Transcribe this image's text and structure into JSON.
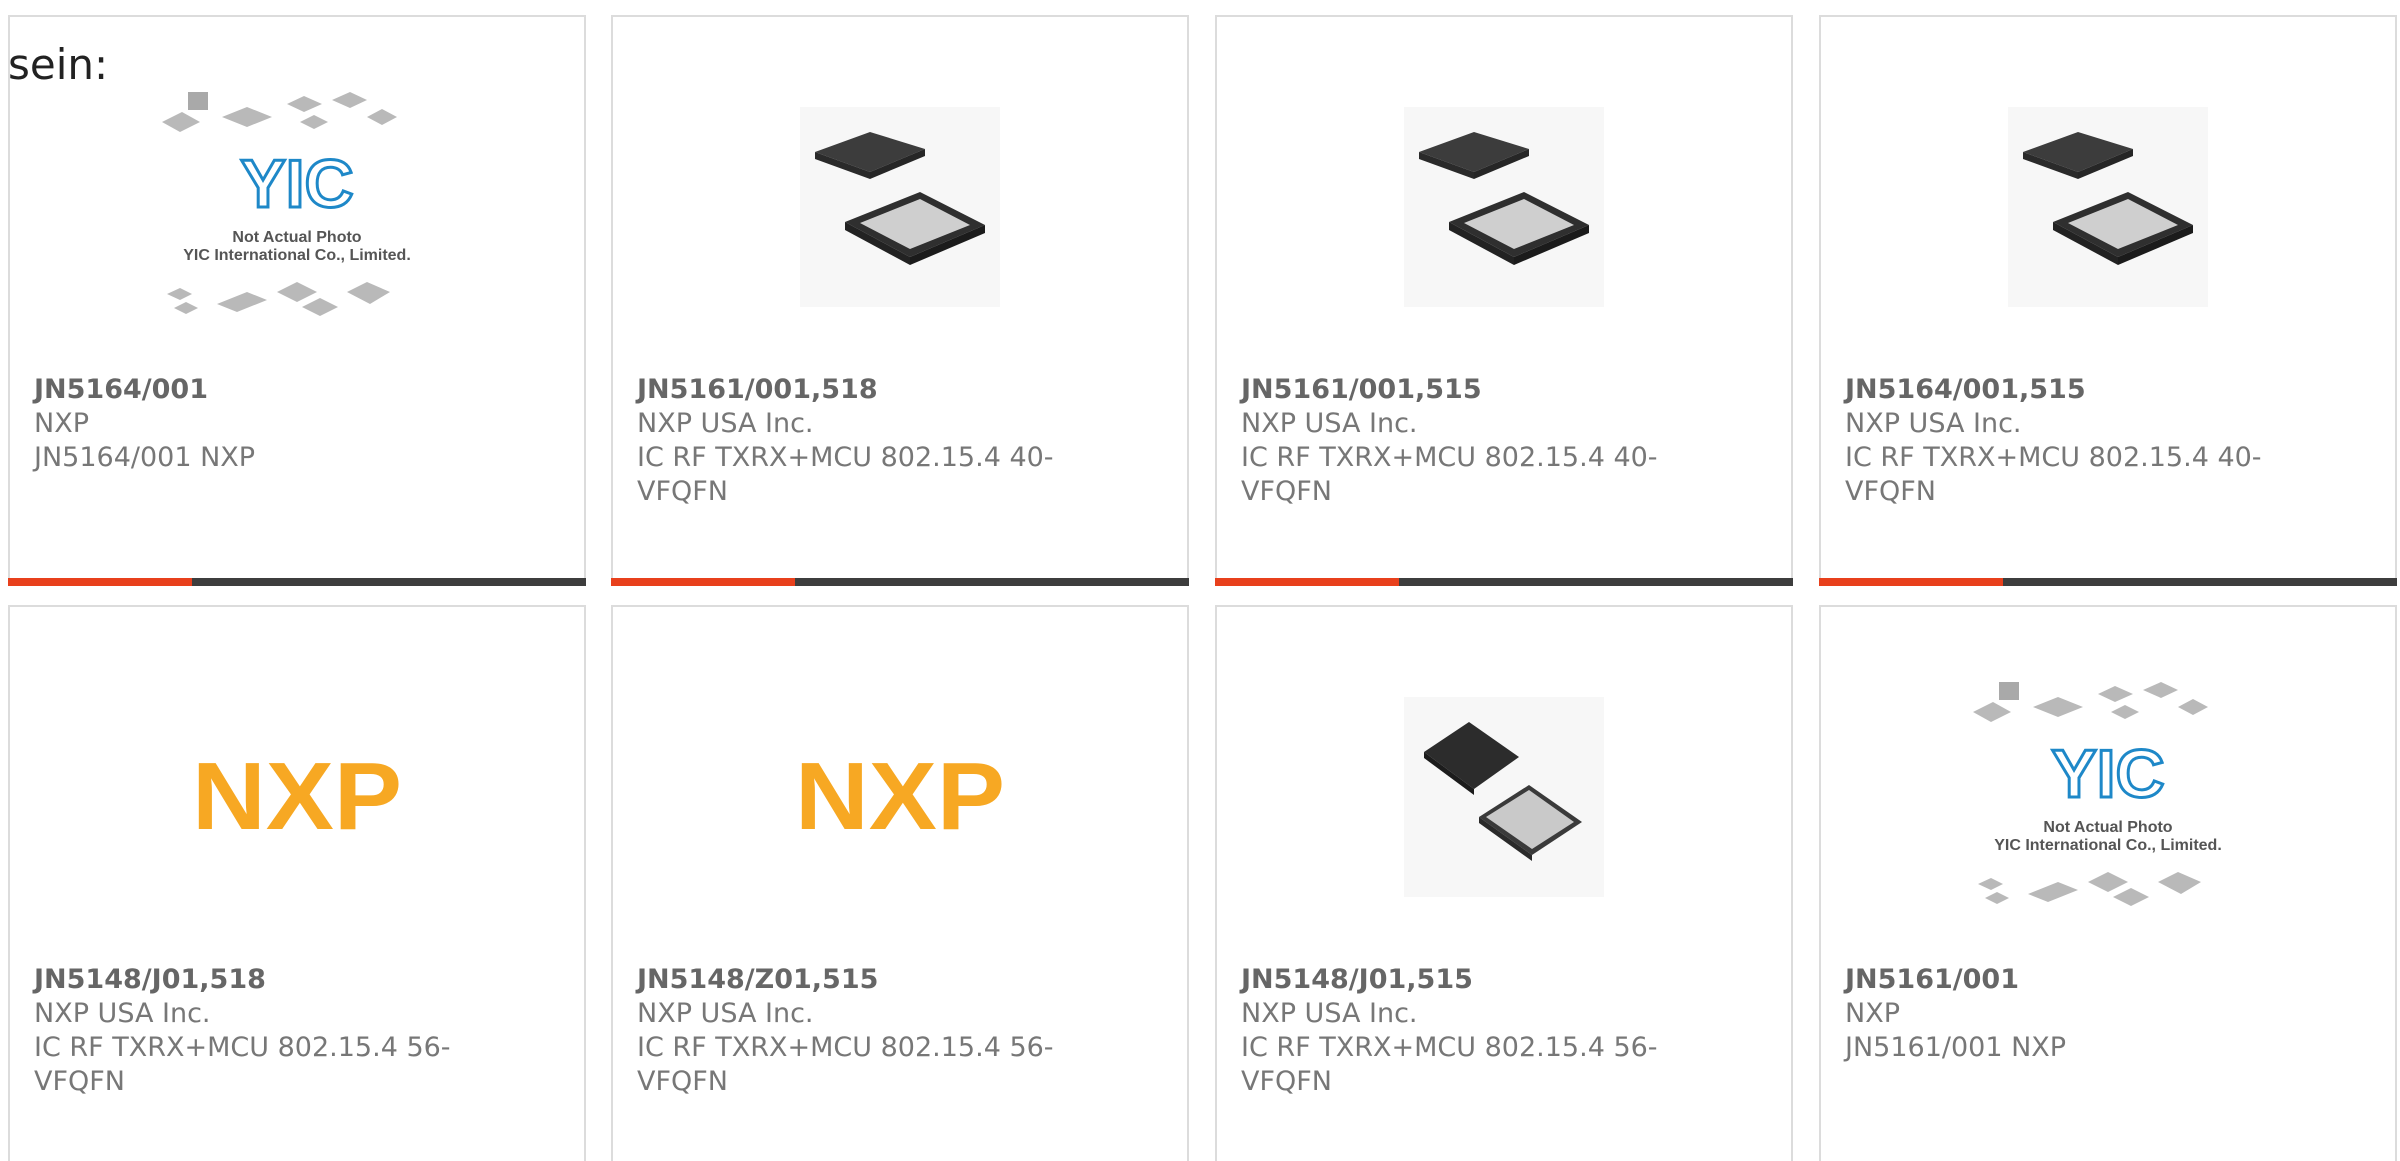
{
  "intro_text": "sein:",
  "colors": {
    "accent": "#e8401c",
    "bar": "#3d3d3d",
    "border": "#dcdcdc",
    "text": "#777777",
    "nxp_orange": "#f7a823",
    "nxp_blue": "#6fa8dc",
    "nxp_green": "#b9cf3a"
  },
  "products": [
    {
      "part_number": "JN5164/001",
      "manufacturer": "NXP",
      "description": "JN5164/001 NXP",
      "image": "not-actual-photo",
      "placeholder_line1": "Not Actual Photo",
      "placeholder_line2": "YIC International Co., Limited.",
      "placeholder_brand": "YIC"
    },
    {
      "part_number": "JN5161/001,518",
      "manufacturer": "NXP USA Inc.",
      "description": "IC RF TXRX+MCU 802.15.4 40-VFQFN",
      "image": "qfn-chip"
    },
    {
      "part_number": "JN5161/001,515",
      "manufacturer": "NXP USA Inc.",
      "description": "IC RF TXRX+MCU 802.15.4 40-VFQFN",
      "image": "qfn-chip"
    },
    {
      "part_number": "JN5164/001,515",
      "manufacturer": "NXP USA Inc.",
      "description": "IC RF TXRX+MCU 802.15.4 40-VFQFN",
      "image": "qfn-chip"
    },
    {
      "part_number": "JN5148/J01,518",
      "manufacturer": "NXP USA Inc.",
      "description": "IC RF TXRX+MCU 802.15.4 56-VFQFN",
      "image": "nxp-logo",
      "logo_text": "NXP"
    },
    {
      "part_number": "JN5148/Z01,515",
      "manufacturer": "NXP USA Inc.",
      "description": "IC RF TXRX+MCU 802.15.4 56-VFQFN",
      "image": "nxp-logo",
      "logo_text": "NXP"
    },
    {
      "part_number": "JN5148/J01,515",
      "manufacturer": "NXP USA Inc.",
      "description": "IC RF TXRX+MCU 802.15.4 56-VFQFN",
      "image": "qfn-chip-angled"
    },
    {
      "part_number": "JN5161/001",
      "manufacturer": "NXP",
      "description": "JN5161/001 NXP",
      "image": "not-actual-photo",
      "placeholder_line1": "Not Actual Photo",
      "placeholder_line2": "YIC International Co., Limited.",
      "placeholder_brand": "YIC"
    }
  ]
}
